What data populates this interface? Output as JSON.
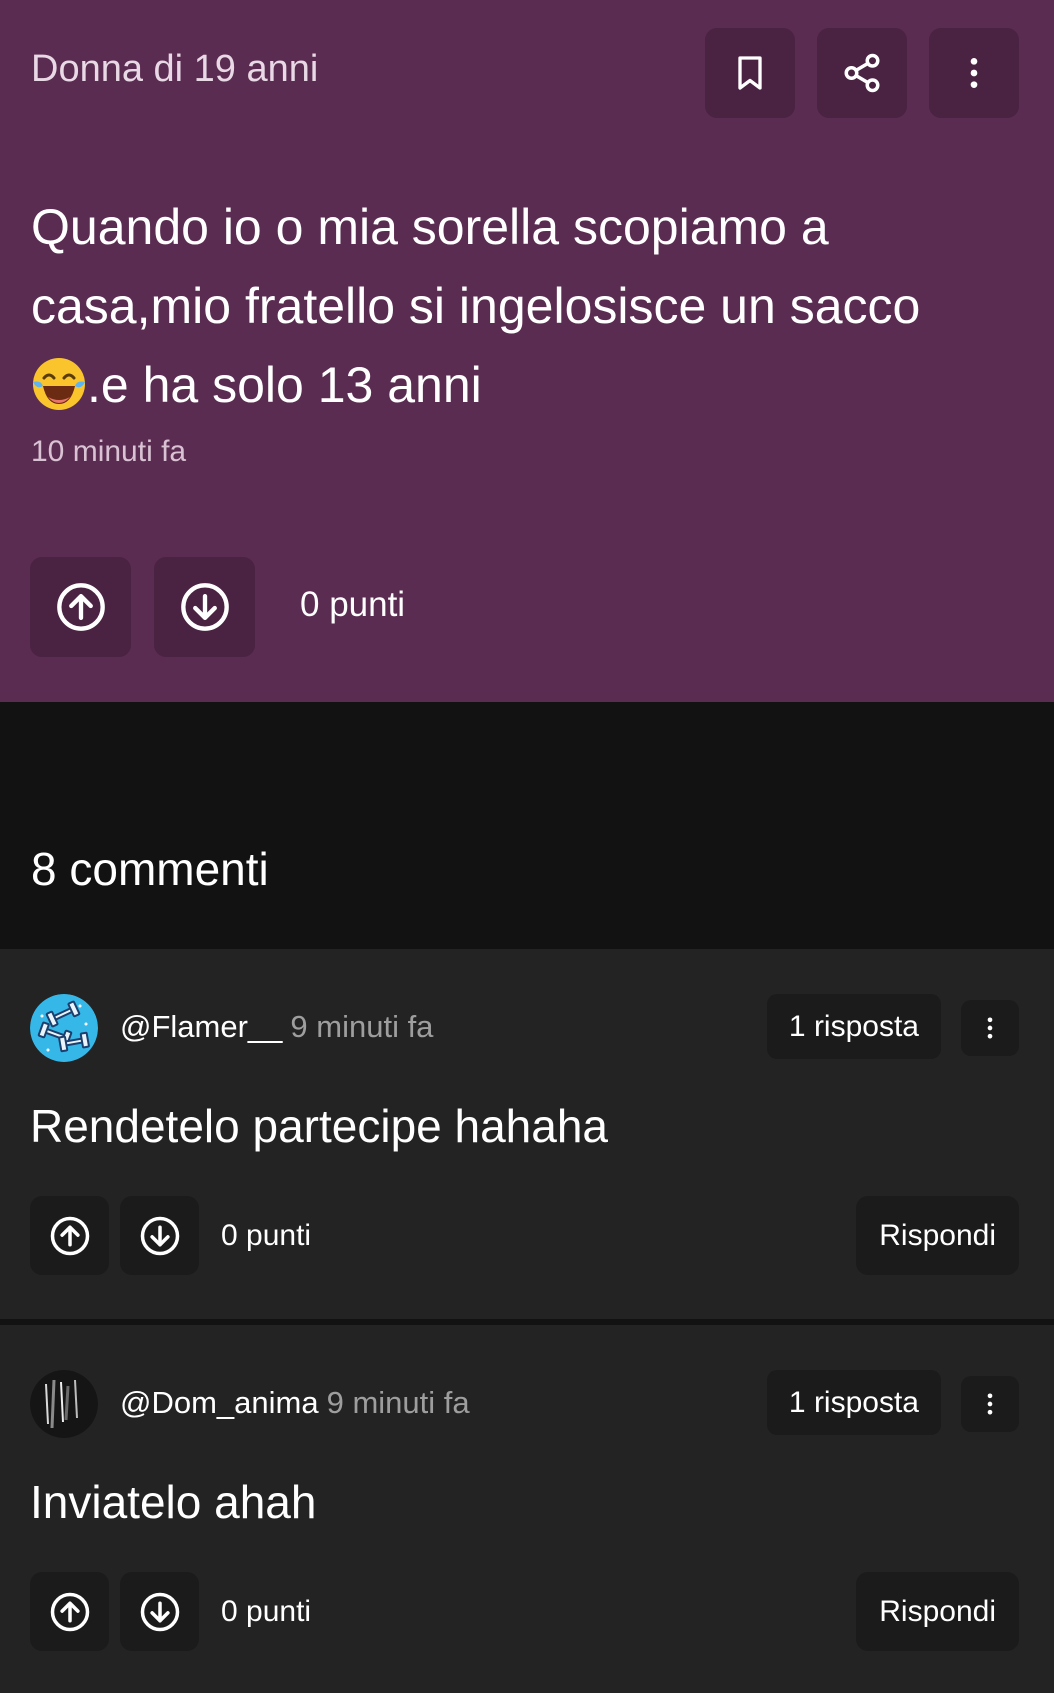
{
  "post": {
    "author_meta": "Donna di 19 anni",
    "text_line1": "Quando io o mia sorella scopiamo a",
    "text_line2": "casa,mio fratello si ingelosisce un sacco",
    "text_line3": ".e ha solo 13 anni",
    "time": "10 minuti fa",
    "points": "0 punti"
  },
  "comments_header": "8 commenti",
  "comments": [
    {
      "username": "@Flamer__",
      "time": "9 minuti fa",
      "reply_count": "1 risposta",
      "text": "Rendetelo partecipe hahaha",
      "points": "0 punti",
      "reply_label": "Rispondi"
    },
    {
      "username": "@Dom_anima",
      "time": "9 minuti fa",
      "reply_count": "1 risposta",
      "text": "Inviatelo ahah",
      "points": "0 punti",
      "reply_label": "Rispondi"
    }
  ],
  "icons": {
    "bookmark": "bookmark-icon",
    "share": "share-icon",
    "more": "more-vertical-icon",
    "upvote": "arrow-up-circle-icon",
    "downvote": "arrow-down-circle-icon",
    "emoji": "laughing-tears-emoji"
  },
  "colors": {
    "post_bg": "#5b2c51",
    "post_button_bg": "#4a2242",
    "page_bg": "#121212",
    "comment_bg": "#232323"
  }
}
